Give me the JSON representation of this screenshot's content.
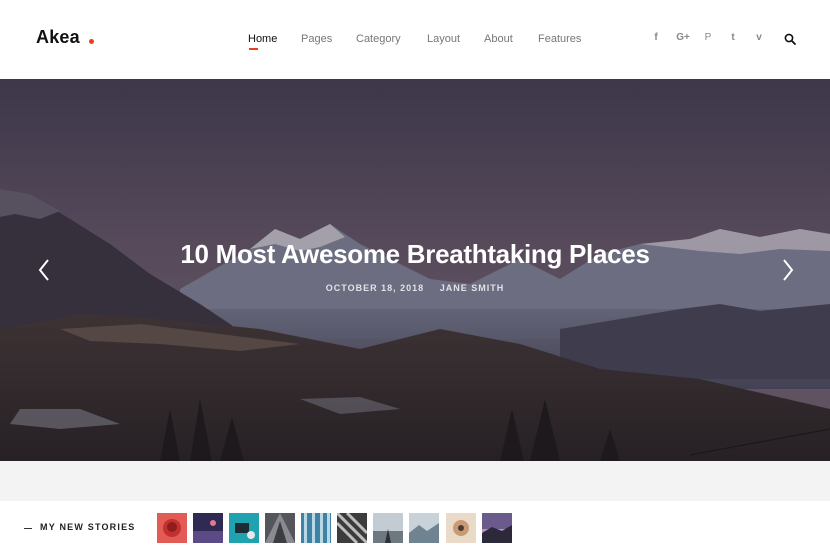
{
  "header": {
    "logo": "Akea",
    "nav": [
      {
        "label": "Home",
        "active": true
      },
      {
        "label": "Pages",
        "active": false
      },
      {
        "label": "Category",
        "active": false
      },
      {
        "label": "Layout",
        "active": false
      },
      {
        "label": "About",
        "active": false
      },
      {
        "label": "Features",
        "active": false
      }
    ],
    "social": [
      {
        "icon": "facebook-icon",
        "glyph": "f"
      },
      {
        "icon": "google-plus-icon",
        "glyph": "G+"
      },
      {
        "icon": "pinterest-icon",
        "glyph": "P"
      },
      {
        "icon": "twitter-icon",
        "glyph": "t"
      },
      {
        "icon": "vimeo-icon",
        "glyph": "v"
      }
    ],
    "search_icon": "search-icon",
    "accent": "#e8401c"
  },
  "hero": {
    "title": "10 Most Awesome Breathtaking Places",
    "date": "OCTOBER 18, 2018",
    "author": "JANE SMITH",
    "prev_icon": "chevron-left-icon",
    "next_icon": "chevron-right-icon"
  },
  "stories": {
    "label": "MY NEW STORIES",
    "thumbnails": [
      {
        "name": "story-thumb-1",
        "color": "#d9433f"
      },
      {
        "name": "story-thumb-2",
        "color": "#3b2f5c"
      },
      {
        "name": "story-thumb-3",
        "color": "#1f9aa8"
      },
      {
        "name": "story-thumb-4",
        "color": "#6a6a70"
      },
      {
        "name": "story-thumb-5",
        "color": "#4b8fb0"
      },
      {
        "name": "story-thumb-6",
        "color": "#555555"
      },
      {
        "name": "story-thumb-7",
        "color": "#a9b4bd"
      },
      {
        "name": "story-thumb-8",
        "color": "#8a9aa3"
      },
      {
        "name": "story-thumb-9",
        "color": "#d9c2a8"
      },
      {
        "name": "story-thumb-10",
        "color": "#8f74a6"
      }
    ]
  }
}
